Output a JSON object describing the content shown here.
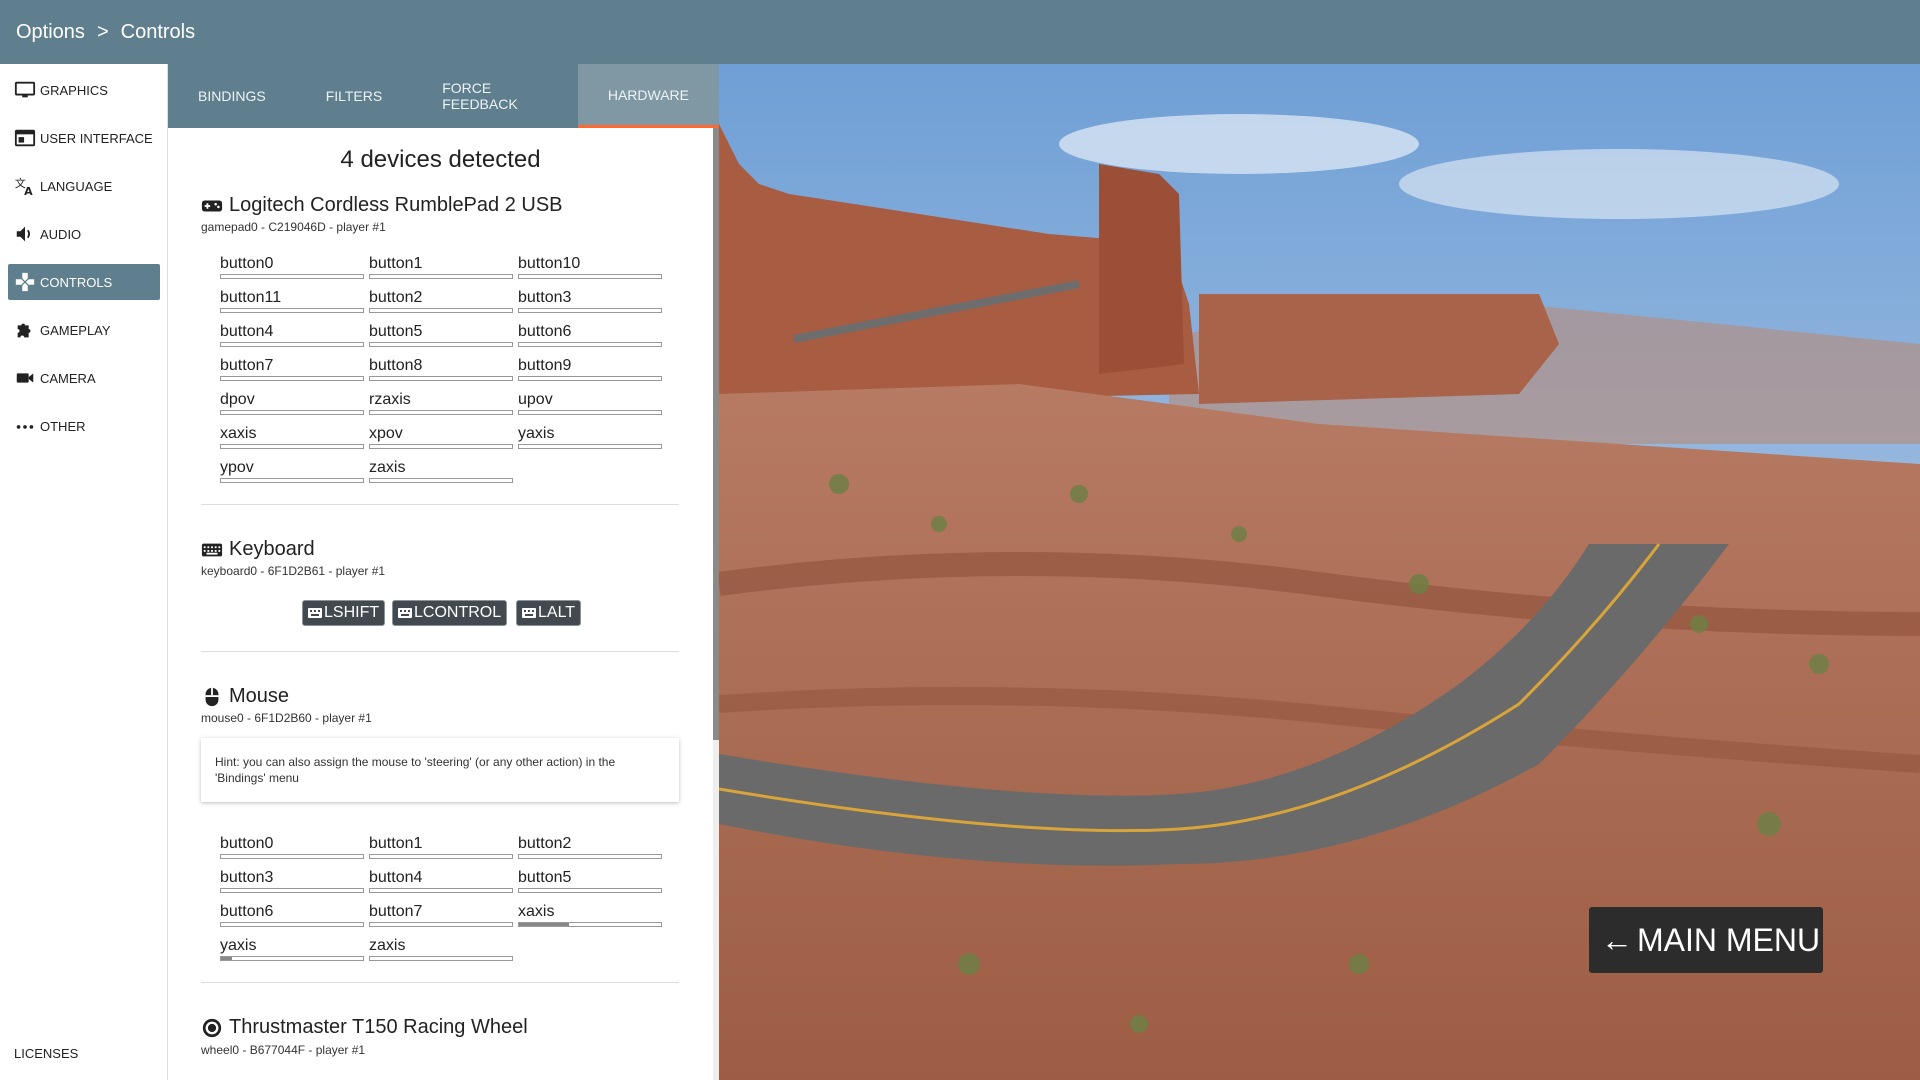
{
  "header": {
    "crumb1": "Options",
    "separator": ">",
    "crumb2": "Controls"
  },
  "nav": {
    "items": [
      {
        "label": "GRAPHICS",
        "icon": "monitor-icon"
      },
      {
        "label": "USER INTERFACE",
        "icon": "window-icon"
      },
      {
        "label": "LANGUAGE",
        "icon": "translate-icon"
      },
      {
        "label": "AUDIO",
        "icon": "speaker-icon"
      },
      {
        "label": "CONTROLS",
        "icon": "gamepad-icon",
        "active": true
      },
      {
        "label": "GAMEPLAY",
        "icon": "puzzle-icon"
      },
      {
        "label": "CAMERA",
        "icon": "videocam-icon"
      },
      {
        "label": "OTHER",
        "icon": "more-dots-icon"
      }
    ],
    "licenses": "LICENSES"
  },
  "tabs": [
    {
      "label": "BINDINGS"
    },
    {
      "label": "FILTERS"
    },
    {
      "label": "FORCE FEEDBACK"
    },
    {
      "label": "HARDWARE",
      "active": true
    }
  ],
  "devices_title": "4 devices detected",
  "gamepad": {
    "name": "Logitech Cordless RumblePad 2 USB",
    "id": "gamepad0 - C219046D - player #1",
    "axes": [
      "button0",
      "button1",
      "button10",
      "button11",
      "button2",
      "button3",
      "button4",
      "button5",
      "button6",
      "button7",
      "button8",
      "button9",
      "dpov",
      "rzaxis",
      "upov",
      "xaxis",
      "xpov",
      "yaxis",
      "ypov",
      "zaxis"
    ]
  },
  "keyboard": {
    "name": "Keyboard",
    "id": "keyboard0 - 6F1D2B61 - player #1",
    "keys": [
      "LSHIFT",
      "LCONTROL",
      "LALT"
    ]
  },
  "mouse": {
    "name": "Mouse",
    "id": "mouse0 - 6F1D2B60 - player #1",
    "hint": "Hint: you can also assign the mouse to 'steering' (or any other action) in the 'Bindings' menu",
    "axes": [
      {
        "label": "button0",
        "level": 0
      },
      {
        "label": "button1",
        "level": 0
      },
      {
        "label": "button2",
        "level": 0
      },
      {
        "label": "button3",
        "level": 0
      },
      {
        "label": "button4",
        "level": 0
      },
      {
        "label": "button5",
        "level": 0
      },
      {
        "label": "button6",
        "level": 0
      },
      {
        "label": "button7",
        "level": 0
      },
      {
        "label": "xaxis",
        "level": 0.35
      },
      {
        "label": "yaxis",
        "level": 0.08
      },
      {
        "label": "zaxis",
        "level": 0
      }
    ]
  },
  "wheel": {
    "name": "Thrustmaster T150 Racing Wheel",
    "id": "wheel0 - B677044F - player #1"
  },
  "main_menu": {
    "arrow": "←",
    "label": "MAIN MENU"
  }
}
